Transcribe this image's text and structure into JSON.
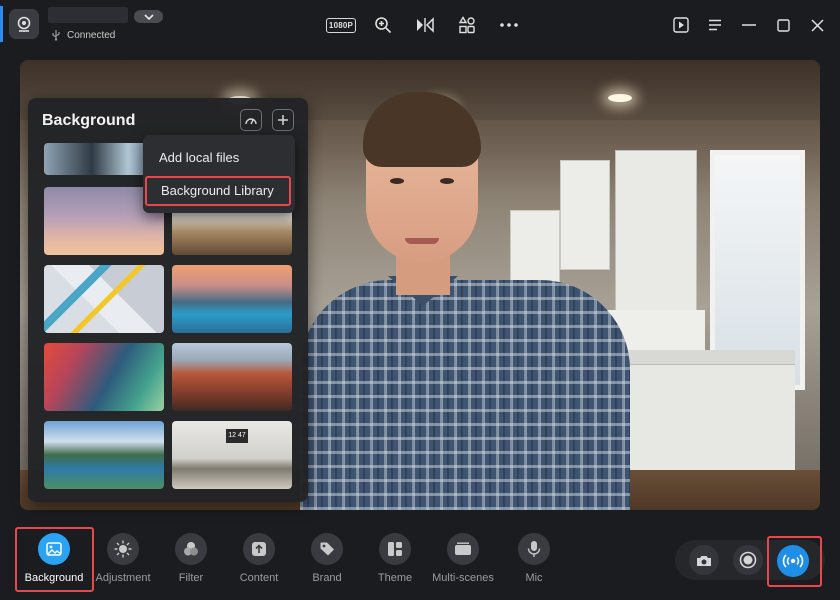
{
  "titlebar": {
    "status_text": "Connected",
    "resolution_badge": "1080P",
    "icons": [
      "webcam-icon",
      "dropdown-chevron-icon",
      "usb-icon",
      "zoom-in-icon",
      "mirror-icon",
      "shapes-icon",
      "more-icon",
      "play-window-icon",
      "menu-icon",
      "minimize-icon",
      "maximize-icon",
      "close-icon"
    ]
  },
  "background_panel": {
    "title": "Background",
    "header_buttons": [
      "speed-icon",
      "plus-icon"
    ],
    "menu": {
      "add_local": "Add local files",
      "library": "Background Library"
    },
    "thumbnail_clock": "12 47"
  },
  "toolbar": {
    "items": [
      {
        "label": "Background",
        "icon": "image-icon",
        "active": true
      },
      {
        "label": "Adjustment",
        "icon": "sun-icon",
        "active": false
      },
      {
        "label": "Filter",
        "icon": "filter-circles-icon",
        "active": false
      },
      {
        "label": "Content",
        "icon": "upload-icon",
        "active": false
      },
      {
        "label": "Brand",
        "icon": "tag-icon",
        "active": false
      },
      {
        "label": "Theme",
        "icon": "layout-icon",
        "active": false
      },
      {
        "label": "Multi-scenes",
        "icon": "scenes-icon",
        "active": false
      },
      {
        "label": "Mic",
        "icon": "mic-icon",
        "active": false
      }
    ],
    "right_icons": [
      "camera-icon",
      "record-icon",
      "live-broadcast-icon"
    ]
  },
  "colors": {
    "accent": "#2aa3f5",
    "highlight": "#e5484d",
    "bg": "#1b1c1f"
  }
}
